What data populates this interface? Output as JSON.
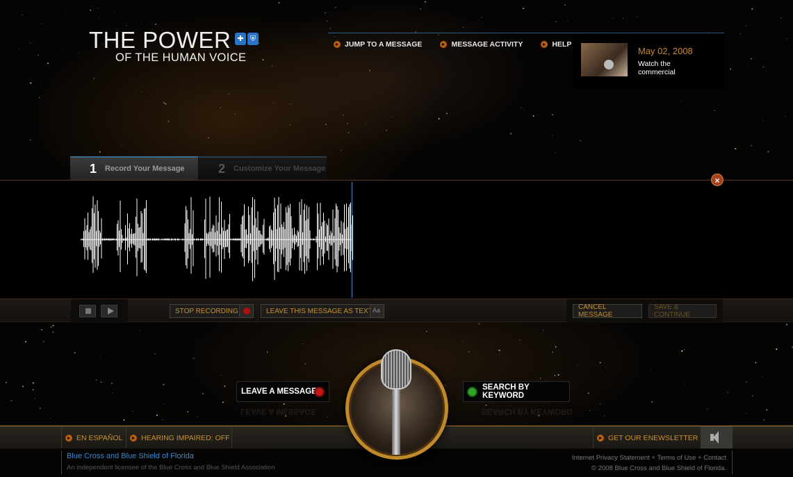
{
  "logo": {
    "line1": "THE POWER",
    "line2": "OF THE HUMAN VOICE"
  },
  "nav": {
    "items": [
      "JUMP TO A MESSAGE",
      "MESSAGE ACTIVITY",
      "HELP"
    ]
  },
  "promo": {
    "date": "May 02, 2008",
    "watch": "Watch the commercial"
  },
  "tabs": [
    {
      "num": "1",
      "label": "Record Your Message"
    },
    {
      "num": "2",
      "label": "Customize Your Message"
    }
  ],
  "close_label": "×",
  "controls": {
    "stop_recording": "STOP RECORDING",
    "leave_text": "LEAVE THIS MESSAGE AS TEXT",
    "aa": "Aa",
    "cancel": "CANCEL MESSAGE",
    "save": "SAVE & CONTINUE"
  },
  "main": {
    "leave_message": "LEAVE A MESSAGE",
    "search_keyword": "SEARCH BY KEYWORD"
  },
  "footer": {
    "espanol": "EN ESPAÑOL",
    "hearing": "HEARING IMPAIRED: OFF",
    "newsletter": "GET OUR ENEWSLETTER",
    "company": "Blue Cross and Blue Shield of Florida",
    "licensee": "An independent licensee of the Blue Cross and Blue Shield Association",
    "privacy": "Internet Privacy Statement",
    "terms": "Terms of Use",
    "contact": "Contact",
    "copyright": "© 2008 Blue Cross and Blue Shield of Florida."
  },
  "icons": {
    "bullet": "arrow-bullet-icon",
    "record": "record-dot-icon",
    "close": "close-icon",
    "speaker": "speaker-icon"
  },
  "colors": {
    "accent": "#c9922a",
    "link": "#3a8ad0",
    "record": "#c01717",
    "search": "#2fa32a"
  }
}
